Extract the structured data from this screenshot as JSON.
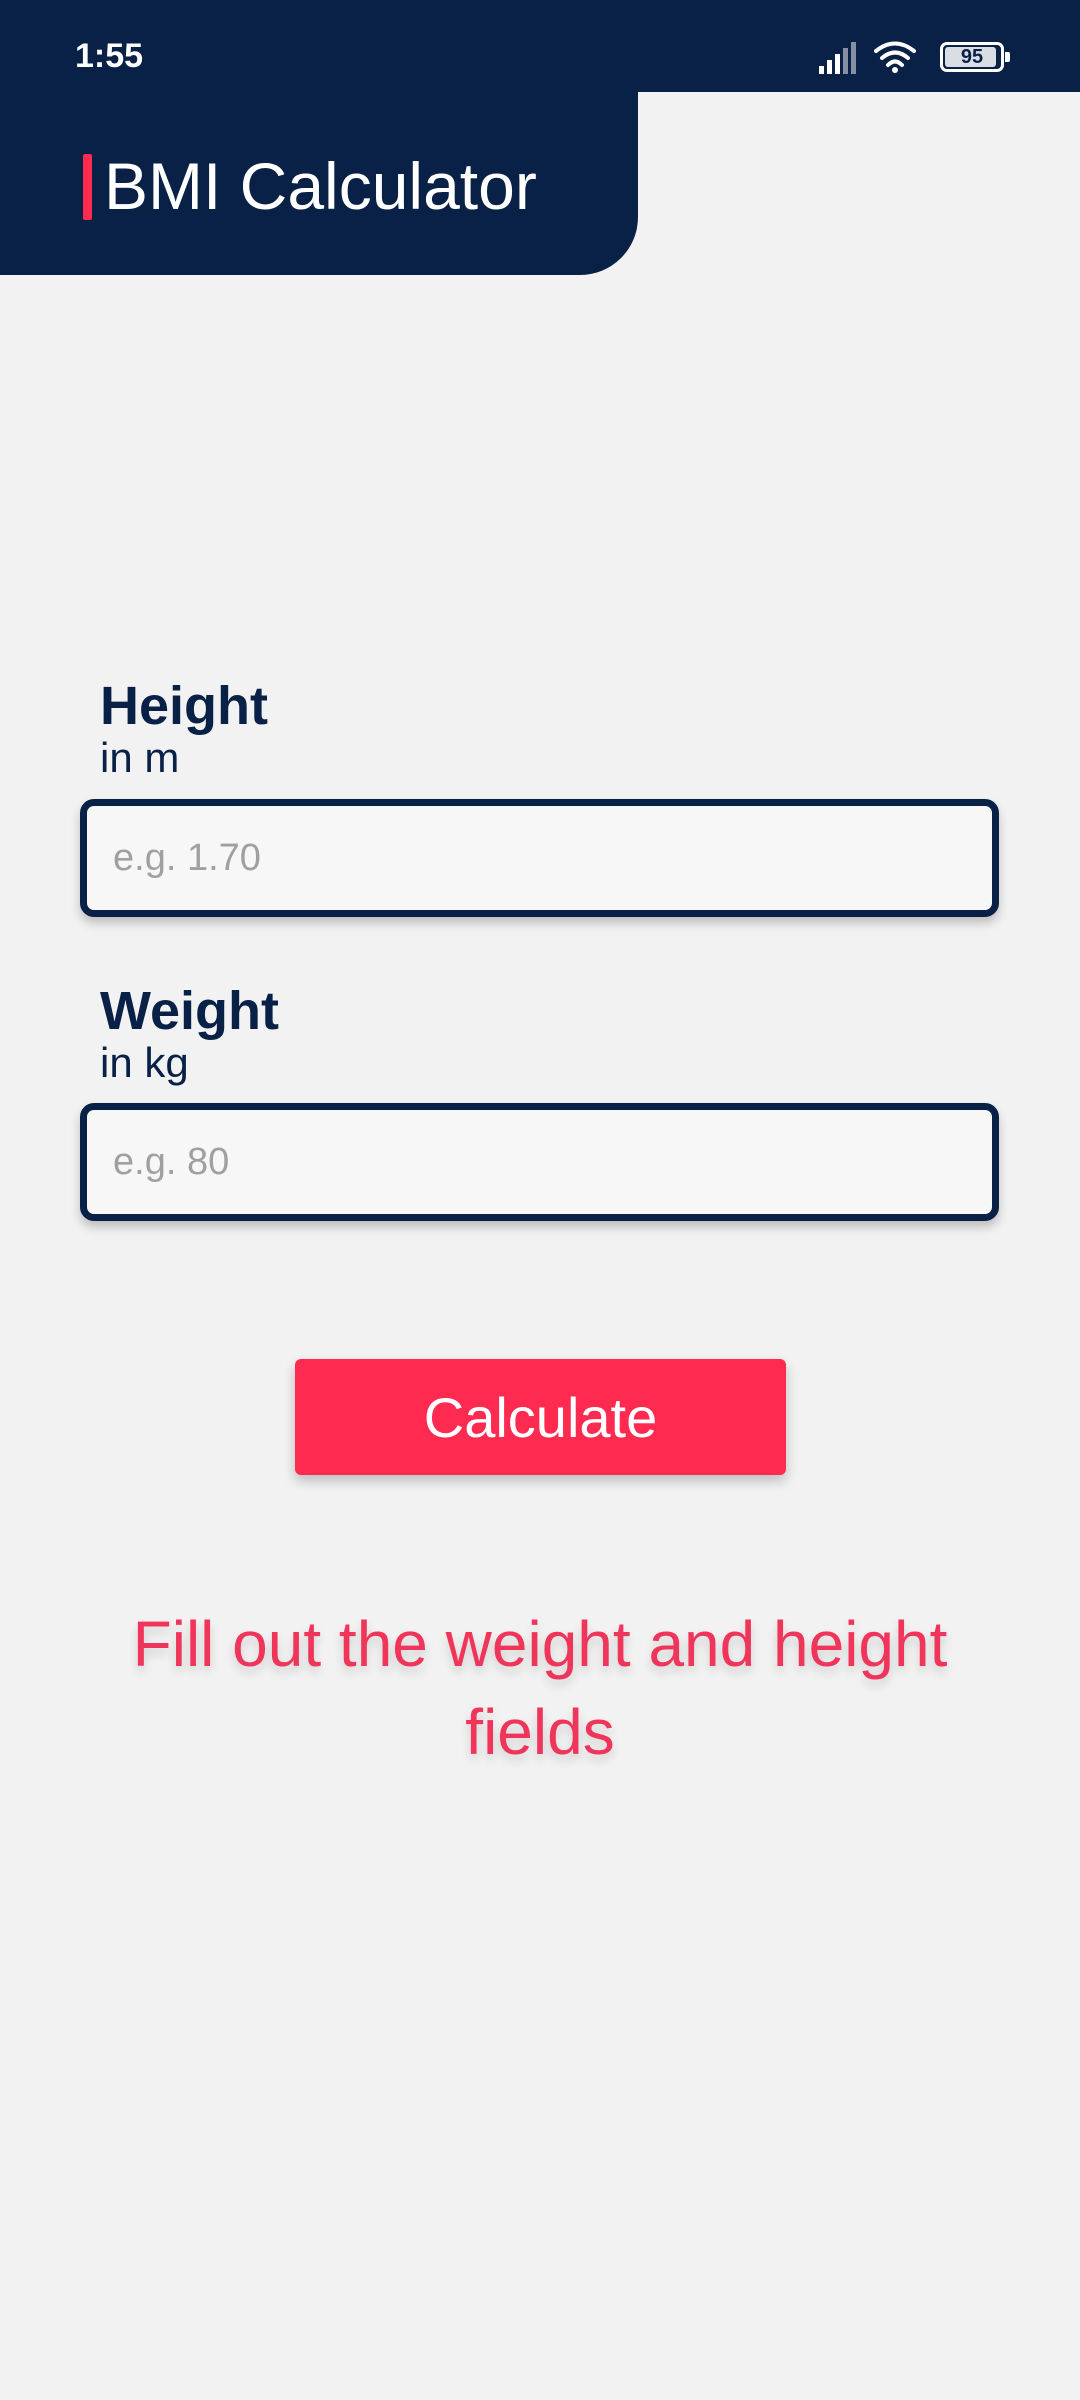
{
  "status_bar": {
    "time": "1:55",
    "battery": "95",
    "battery_level": 0.95,
    "icons": [
      "signal-icon",
      "wifi-icon",
      "battery-icon"
    ]
  },
  "header": {
    "title": "BMI Calculator"
  },
  "form": {
    "height": {
      "label": "Height",
      "unit": "in m",
      "placeholder": "e.g. 1.70",
      "value": ""
    },
    "weight": {
      "label": "Weight",
      "unit": "in kg",
      "placeholder": "e.g. 80",
      "value": ""
    },
    "calculate_label": "Calculate"
  },
  "message": "Fill out the weight and height fields",
  "colors": {
    "navy": "#0a2147",
    "accent": "#ff2a4f",
    "message": "#f0355a",
    "background": "#f2f2f2"
  }
}
